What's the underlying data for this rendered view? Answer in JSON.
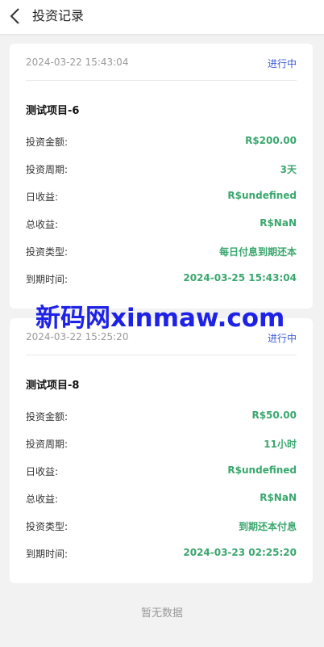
{
  "header": {
    "title": "投资记录"
  },
  "records": [
    {
      "time": "2024-03-22 15:43:04",
      "status": "进行中",
      "name": "测试项目-6",
      "rows": [
        {
          "label": "投资金额:",
          "value": "R$200.00"
        },
        {
          "label": "投资周期:",
          "value": "3天"
        },
        {
          "label": "日收益:",
          "value": "R$undefined"
        },
        {
          "label": "总收益:",
          "value": "R$NaN"
        },
        {
          "label": "投资类型:",
          "value": "每日付息到期还本"
        },
        {
          "label": "到期时间:",
          "value": "2024-03-25 15:43:04"
        }
      ]
    },
    {
      "time": "2024-03-22 15:25:20",
      "status": "进行中",
      "name": "测试项目-8",
      "rows": [
        {
          "label": "投资金额:",
          "value": "R$50.00"
        },
        {
          "label": "投资周期:",
          "value": "11小时"
        },
        {
          "label": "日收益:",
          "value": "R$undefined"
        },
        {
          "label": "总收益:",
          "value": "R$NaN"
        },
        {
          "label": "投资类型:",
          "value": "到期还本付息"
        },
        {
          "label": "到期时间:",
          "value": "2024-03-23 02:25:20"
        }
      ]
    }
  ],
  "watermark": "新码网xinmaw.com",
  "empty_text": "暂无数据",
  "colors": {
    "accent": "#3b5bd6",
    "value": "#3aa76d",
    "watermark": "#1e22e6"
  }
}
